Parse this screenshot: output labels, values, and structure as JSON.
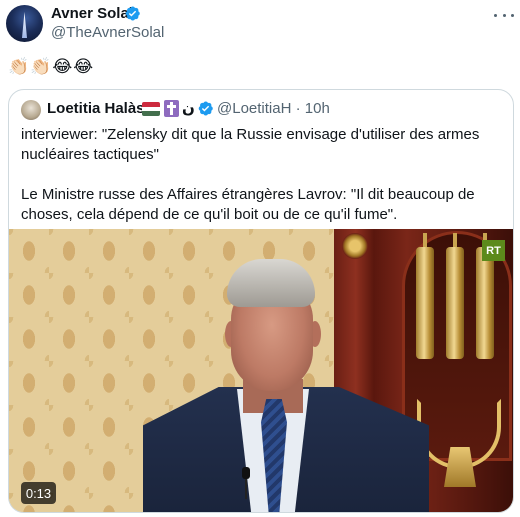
{
  "author": {
    "name": "Avner Solal",
    "handle": "@TheAvnerSolal"
  },
  "tweet": {
    "text": "👏🏻👏🏻😂😂"
  },
  "quote": {
    "author_name": "Loetitia Halàsz",
    "name_suffix": "ن",
    "handle_time": "@LoetitiaH · 10h",
    "paragraphs": [
      "interviewer:  \"Zelensky dit que la Russie envisage d'utiliser des armes nucléaires tactiques\"",
      "Le Ministre russe des Affaires étrangères Lavrov: \"Il dit beaucoup de choses, cela dépend de ce qu'il boit ou de ce qu'il fume\"."
    ],
    "video": {
      "duration": "0:13",
      "channel_logo": "RT"
    }
  },
  "colors": {
    "verified": "#1d9bf0",
    "secondary_text": "#536471",
    "border": "#cfd9de"
  },
  "icons": {
    "verified": "verified-badge-icon",
    "more": "more-dots-icon",
    "flag": "hungary-flag-icon",
    "cross": "latin-cross-icon"
  }
}
